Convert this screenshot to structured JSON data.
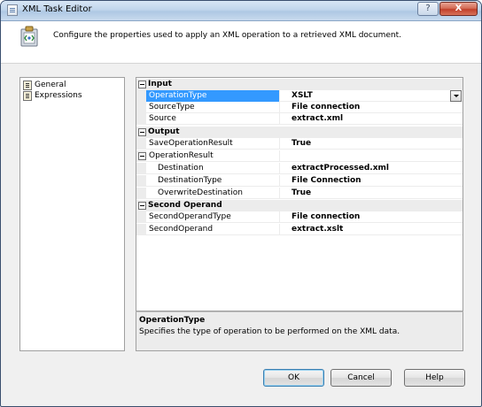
{
  "window": {
    "title": "XML Task Editor",
    "help_glyph": "?",
    "close_glyph": "X"
  },
  "header": {
    "description": "Configure the properties used to apply an XML operation to a retrieved XML document."
  },
  "nav": {
    "items": [
      {
        "label": "General",
        "icon": "page-icon"
      },
      {
        "label": "Expressions",
        "icon": "page-icon"
      }
    ]
  },
  "grid": {
    "rows": [
      {
        "kind": "category",
        "label": "Input",
        "toggle": "minus"
      },
      {
        "kind": "property",
        "label": "OperationType",
        "value": "XSLT",
        "selected": true,
        "dropdown": true
      },
      {
        "kind": "property",
        "label": "SourceType",
        "value": "File connection"
      },
      {
        "kind": "property",
        "label": "Source",
        "value": "extract.xml"
      },
      {
        "kind": "category",
        "label": "Output",
        "toggle": "minus"
      },
      {
        "kind": "property",
        "label": "SaveOperationResult",
        "value": "True"
      },
      {
        "kind": "group",
        "label": "OperationResult",
        "value": "",
        "toggle": "minus"
      },
      {
        "kind": "subproperty",
        "label": "Destination",
        "value": "extractProcessed.xml"
      },
      {
        "kind": "subproperty",
        "label": "DestinationType",
        "value": "File Connection"
      },
      {
        "kind": "subproperty",
        "label": "OverwriteDestination",
        "value": "True"
      },
      {
        "kind": "category",
        "label": "Second Operand",
        "toggle": "minus"
      },
      {
        "kind": "property",
        "label": "SecondOperandType",
        "value": "File connection"
      },
      {
        "kind": "property",
        "label": "SecondOperand",
        "value": "extract.xslt"
      }
    ]
  },
  "description_panel": {
    "title": "OperationType",
    "text": "Specifies the type of operation to be performed on the XML data."
  },
  "buttons": {
    "ok": "OK",
    "cancel": "Cancel",
    "help": "Help"
  }
}
